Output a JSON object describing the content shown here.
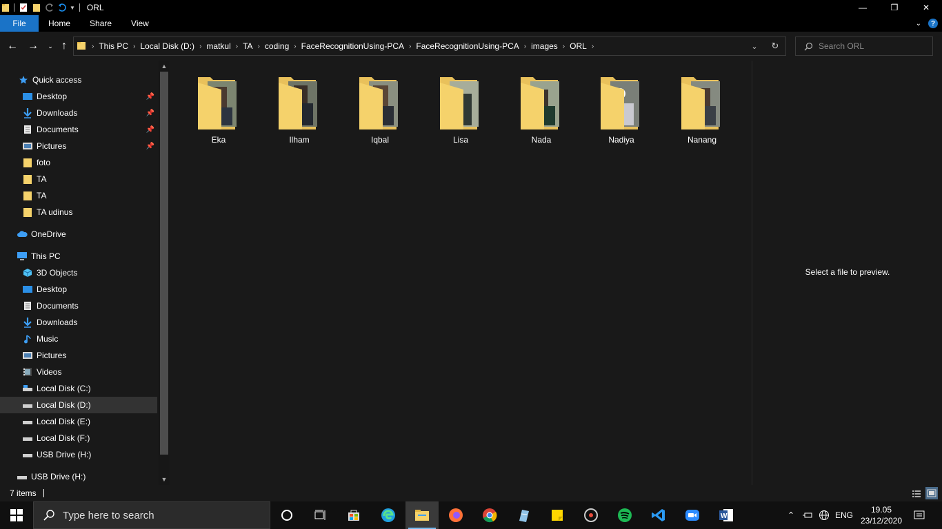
{
  "window": {
    "title": "ORL",
    "controls": {
      "minimize": "—",
      "maximize": "❐",
      "close": "✕"
    }
  },
  "ribbon": {
    "tabs": [
      "File",
      "Home",
      "Share",
      "View"
    ]
  },
  "address": {
    "crumbs": [
      "This PC",
      "Local Disk (D:)",
      "matkul",
      "TA",
      "coding",
      "FaceRecognitionUsing-PCA",
      "FaceRecognitionUsing-PCA",
      "images",
      "ORL"
    ]
  },
  "search": {
    "placeholder": "Search ORL"
  },
  "sidebar": {
    "quick_access": "Quick access",
    "quick_items": [
      {
        "label": "Desktop",
        "pinned": true
      },
      {
        "label": "Downloads",
        "pinned": true
      },
      {
        "label": "Documents",
        "pinned": true
      },
      {
        "label": "Pictures",
        "pinned": true
      },
      {
        "label": "foto",
        "pinned": false
      },
      {
        "label": "TA",
        "pinned": false
      },
      {
        "label": "TA",
        "pinned": false
      },
      {
        "label": "TA udinus",
        "pinned": false
      }
    ],
    "onedrive": "OneDrive",
    "this_pc": "This PC",
    "pc_items": [
      "3D Objects",
      "Desktop",
      "Documents",
      "Downloads",
      "Music",
      "Pictures",
      "Videos",
      "Local Disk (C:)",
      "Local Disk (D:)",
      "Local Disk (E:)",
      "Local Disk (F:)",
      "USB Drive (H:)"
    ],
    "selected": "Local Disk (D:)",
    "usb": "USB Drive (H:)"
  },
  "folders": [
    "Eka",
    "Ilham",
    "Iqbal",
    "Lisa",
    "Nada",
    "Nadiya",
    "Nanang"
  ],
  "preview": {
    "text": "Select a file to preview."
  },
  "status": {
    "count": "7 items"
  },
  "taskbar": {
    "search_placeholder": "Type here to search",
    "lang": "ENG",
    "time": "19.05",
    "date": "23/12/2020"
  },
  "colors": {
    "accent": "#1a73c7",
    "folder": "#f5d26b",
    "background": "#191919"
  }
}
